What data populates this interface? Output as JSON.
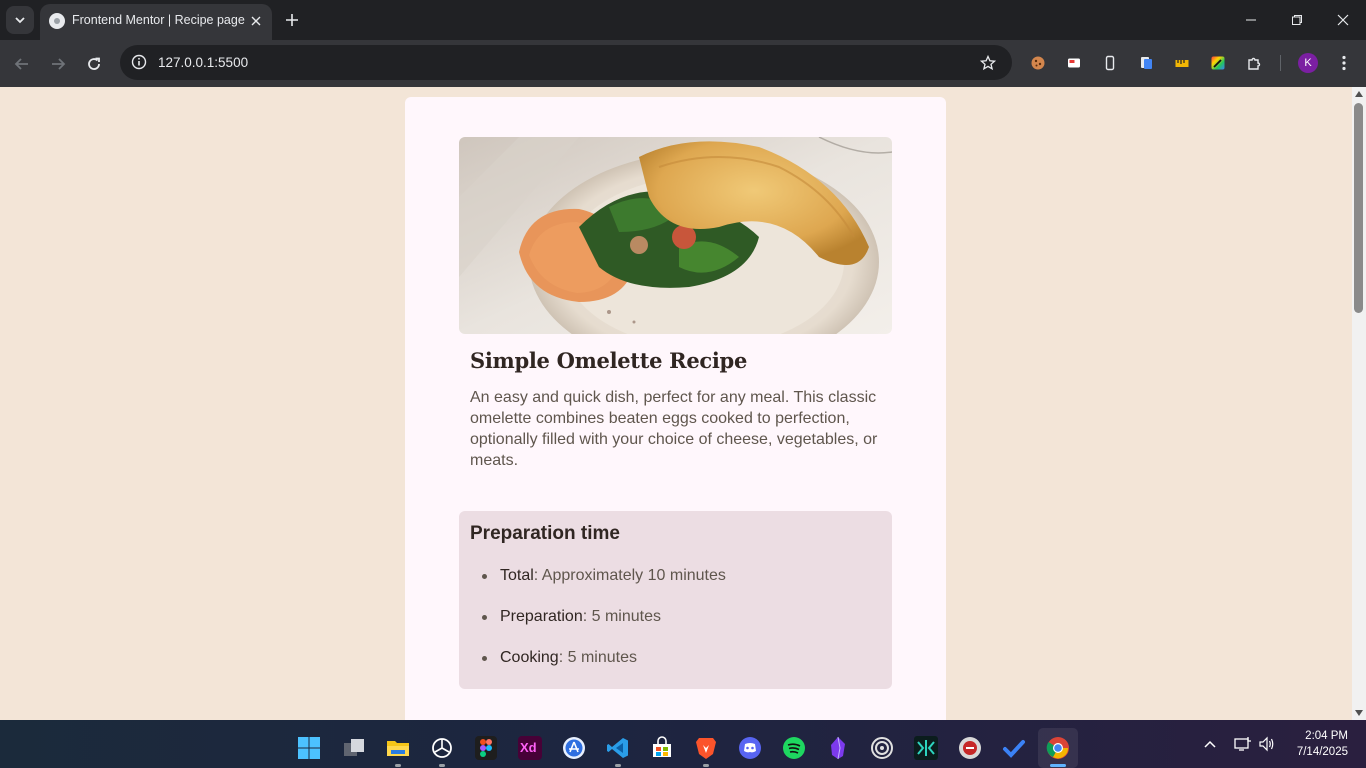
{
  "browser": {
    "tab_title": "Frontend Mentor | Recipe page",
    "url": "127.0.0.1:5500",
    "profile_initial": "K"
  },
  "recipe": {
    "title": "Simple Omelette Recipe",
    "description": "An easy and quick dish, perfect for any meal. This classic omelette combines beaten eggs cooked to perfection, optionally filled with your choice of cheese, vegetables, or meats.",
    "prep": {
      "heading": "Preparation time",
      "items": [
        {
          "label": "Total",
          "value": ": Approximately 10 minutes"
        },
        {
          "label": "Preparation",
          "value": ": 5 minutes"
        },
        {
          "label": "Cooking",
          "value": ": 5 minutes"
        }
      ]
    }
  },
  "taskbar": {
    "apps": [
      "start-icon",
      "task-view-icon",
      "file-explorer-icon",
      "chatgpt-icon",
      "figma-icon",
      "adobe-xd-icon",
      "app-store-icon",
      "vscode-icon",
      "microsoft-store-icon",
      "brave-icon",
      "discord-icon",
      "spotify-icon",
      "obsidian-icon",
      "app-circle-icon",
      "app-green-icon",
      "app-badge-icon",
      "todo-icon",
      "chrome-icon"
    ],
    "xd_label": "Xd",
    "time": "2:04 PM",
    "date": "7/14/2025"
  },
  "colors": {
    "page_bg": "#f3e5d7",
    "card_bg": "#fff7fc",
    "prep_bg": "#ecdde3",
    "heading_text": "#302622",
    "body_text": "#5f564d"
  }
}
